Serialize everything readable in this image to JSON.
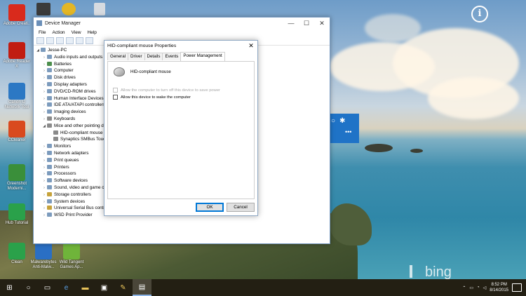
{
  "desktop": {
    "icons": [
      {
        "label": "Adobe Creati..",
        "color": "#d92a1c"
      },
      {
        "label": "Adobe Reader X",
        "color": "#c11d12"
      },
      {
        "label": "Canon IJ Network Tool",
        "color": "#2c78c4"
      },
      {
        "label": "CCleaner",
        "color": "#d94a1e"
      },
      {
        "label": "Greenshot Moderni...",
        "color": "#3a8f3a"
      },
      {
        "label": "Hub Tutorial",
        "color": "#2aa14a"
      },
      {
        "label": "Clean",
        "color": "#2aa14a"
      },
      {
        "label": "Malwarebytes Anti-Malw...",
        "color": "#2a6fc4"
      },
      {
        "label": "Wild Tangent Games Ap...",
        "color": "#6fb43a"
      }
    ],
    "top_icon_colors": [
      "#3b3b3b",
      "#e4b624",
      "#d7dbe0"
    ],
    "bing_label": "bing",
    "info_glyph": "i"
  },
  "device_manager": {
    "title": "Device Manager",
    "menu": [
      "File",
      "Action",
      "View",
      "Help"
    ],
    "tree": [
      {
        "label": "Jesse-PC",
        "arrow": "◢",
        "indent": 0,
        "icon": "computer"
      },
      {
        "label": "Audio inputs and outputs",
        "arrow": "›",
        "indent": 1,
        "icon": "audio"
      },
      {
        "label": "Batteries",
        "arrow": "›",
        "indent": 1,
        "icon": "battery"
      },
      {
        "label": "Computer",
        "arrow": "›",
        "indent": 1,
        "icon": "computer"
      },
      {
        "label": "Disk drives",
        "arrow": "›",
        "indent": 1,
        "icon": "disk"
      },
      {
        "label": "Display adapters",
        "arrow": "›",
        "indent": 1,
        "icon": "display"
      },
      {
        "label": "DVD/CD-ROM drives",
        "arrow": "›",
        "indent": 1,
        "icon": "dvd"
      },
      {
        "label": "Human Interface Devices",
        "arrow": "›",
        "indent": 1,
        "icon": "hid"
      },
      {
        "label": "IDE ATA/ATAPI controllers",
        "arrow": "›",
        "indent": 1,
        "icon": "ide"
      },
      {
        "label": "Imaging devices",
        "arrow": "›",
        "indent": 1,
        "icon": "imaging"
      },
      {
        "label": "Keyboards",
        "arrow": "›",
        "indent": 1,
        "icon": "keyboard"
      },
      {
        "label": "Mice and other pointing devices",
        "arrow": "◢",
        "indent": 1,
        "icon": "mouse"
      },
      {
        "label": "HID-compliant mouse",
        "arrow": "",
        "indent": 2,
        "icon": "mouse"
      },
      {
        "label": "Synaptics SMBus TouchPad",
        "arrow": "",
        "indent": 2,
        "icon": "mouse"
      },
      {
        "label": "Monitors",
        "arrow": "›",
        "indent": 1,
        "icon": "monitor"
      },
      {
        "label": "Network adapters",
        "arrow": "›",
        "indent": 1,
        "icon": "network"
      },
      {
        "label": "Print queues",
        "arrow": "›",
        "indent": 1,
        "icon": "print"
      },
      {
        "label": "Printers",
        "arrow": "›",
        "indent": 1,
        "icon": "print"
      },
      {
        "label": "Processors",
        "arrow": "›",
        "indent": 1,
        "icon": "cpu"
      },
      {
        "label": "Software devices",
        "arrow": "›",
        "indent": 1,
        "icon": "software"
      },
      {
        "label": "Sound, video and game controllers",
        "arrow": "›",
        "indent": 1,
        "icon": "sound"
      },
      {
        "label": "Storage controllers",
        "arrow": "›",
        "indent": 1,
        "icon": "storage"
      },
      {
        "label": "System devices",
        "arrow": "›",
        "indent": 1,
        "icon": "system"
      },
      {
        "label": "Universal Serial Bus controllers",
        "arrow": "›",
        "indent": 1,
        "icon": "usb"
      },
      {
        "label": "WSD Print Provider",
        "arrow": "›",
        "indent": 1,
        "icon": "print"
      }
    ]
  },
  "properties": {
    "title": "HID-compliant mouse Properties",
    "tabs": [
      "General",
      "Driver",
      "Details",
      "Events",
      "Power Management"
    ],
    "active_tab": 4,
    "device_name": "HID-compliant mouse",
    "option_turn_off": "Allow the computer to turn off this device to save power",
    "option_wake": "Allow this device to wake the computer",
    "ok_label": "OK",
    "cancel_label": "Cancel"
  },
  "blue_panel": {
    "more": "•••"
  },
  "taskbar": {
    "time": "8:52 PM",
    "date": "8/14/2015",
    "accent": "#8cb5e8"
  }
}
